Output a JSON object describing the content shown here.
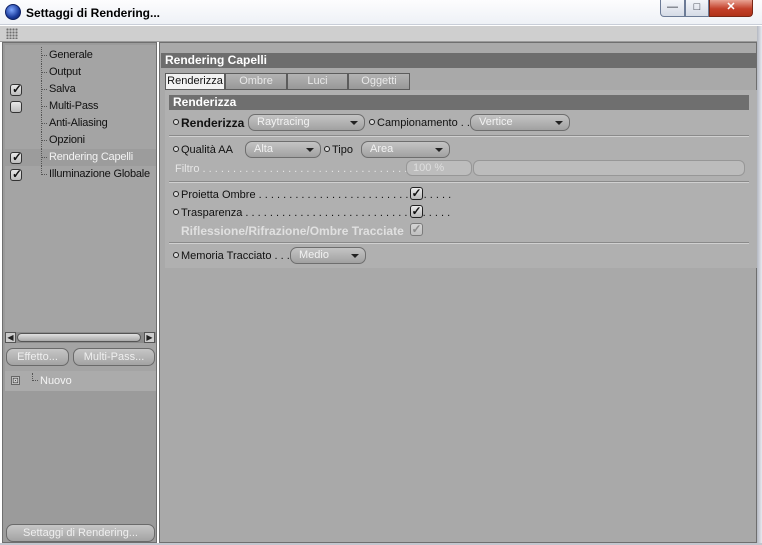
{
  "window": {
    "title": "Settaggi di Rendering...",
    "buttons": {
      "minimize": "—",
      "maximize": "□",
      "close": "✕"
    }
  },
  "sidebar": {
    "items": [
      {
        "label": "Generale",
        "checked": null,
        "selected": false
      },
      {
        "label": "Output",
        "checked": null,
        "selected": false
      },
      {
        "label": "Salva",
        "checked": true,
        "selected": false
      },
      {
        "label": "Multi-Pass",
        "checked": false,
        "selected": false
      },
      {
        "label": "Anti-Aliasing",
        "checked": null,
        "selected": false
      },
      {
        "label": "Opzioni",
        "checked": null,
        "selected": false
      },
      {
        "label": "Rendering Capelli",
        "checked": true,
        "selected": true
      },
      {
        "label": "Illuminazione Globale",
        "checked": true,
        "selected": false
      }
    ],
    "scroll_left": "◀",
    "scroll_right": "▶",
    "effetto_button": "Effetto...",
    "multipass_button": "Multi-Pass...",
    "new_item": {
      "icon": "⊡",
      "label": "Nuovo"
    },
    "settings_button": "Settaggi di Rendering..."
  },
  "main": {
    "title": "Rendering Capelli",
    "tabs": [
      {
        "label": "Renderizza",
        "active": true
      },
      {
        "label": "Ombre",
        "active": false
      },
      {
        "label": "Luci",
        "active": false
      },
      {
        "label": "Oggetti",
        "active": false
      }
    ],
    "section_title": "Renderizza",
    "render_label": "Renderizza",
    "render_value": "Raytracing",
    "campionamento_label": "Campionamento . .",
    "campionamento_value": "Vertice",
    "qualita_label": "Qualità AA",
    "qualita_value": "Alta",
    "tipo_label": "Tipo",
    "tipo_value": "Area",
    "filtro_label": "Filtro . . . . . . . . . . . . . . . . . . . . . . . . . . . . . . . . . . . . . . .",
    "filtro_value": "100 %",
    "proietta_label": "Proietta Ombre . . . . . . . . . . . . . . . . . . . . . . . . . . . . . . . .",
    "proietta_checked": true,
    "trasparenza_label": "Trasparenza . . . . . . . . . . . . . . . . . . . . . . . . . . . . . . . . . .",
    "trasparenza_checked": true,
    "riflessione_label": "Riflessione/Rifrazione/Ombre Tracciate",
    "riflessione_checked": true,
    "memoria_label": "Memoria Tracciato . . .",
    "memoria_value": "Medio",
    "check_glyph": "✓"
  }
}
